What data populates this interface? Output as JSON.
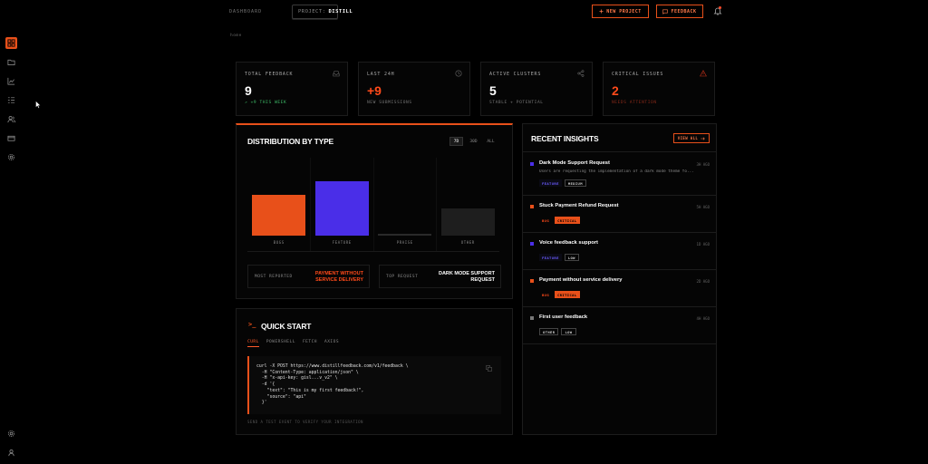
{
  "topbar": {
    "dashboard_label": "DASHBOARD",
    "project_prefix": "PROJECT:",
    "project_name": "DISTILL",
    "new_project_label": "NEW PROJECT",
    "feedback_label": "FEEDBACK"
  },
  "breadcrumb": "home",
  "stats": [
    {
      "label": "TOTAL FEEDBACK",
      "value": "9",
      "sub": "+9 THIS WEEK",
      "icon": "inbox-icon"
    },
    {
      "label": "LAST 24H",
      "value": "+9",
      "sub": "NEW SUBMISSIONS",
      "icon": "clock-icon"
    },
    {
      "label": "ACTIVE CLUSTERS",
      "value": "5",
      "sub": "STABLE + POTENTIAL",
      "icon": "share-icon"
    },
    {
      "label": "CRITICAL ISSUES",
      "value": "2",
      "sub": "NEEDS ATTENTION",
      "icon": "warning-icon"
    }
  ],
  "distribution": {
    "title": "DISTRIBUTION BY TYPE",
    "ranges": [
      "7D",
      "30D",
      "ALL"
    ],
    "active_range": "7D",
    "most_reported_label": "MOST REPORTED",
    "most_reported_value": "PAYMENT WITHOUT SERVICE DELIVERY",
    "top_request_label": "TOP REQUEST",
    "top_request_value": "DARK MODE SUPPORT REQUEST"
  },
  "chart_data": {
    "type": "bar",
    "categories": [
      "BUGS",
      "FEATURE",
      "PRAISE",
      "OTHER"
    ],
    "values": [
      3,
      4,
      0,
      2
    ],
    "colors": [
      "#e8501a",
      "#4a2ee8",
      "#2a2a2a",
      "#1e1e1e"
    ],
    "ylim": [
      0,
      4
    ]
  },
  "quickstart": {
    "title": "QUICK START",
    "tabs": [
      "CURL",
      "POWERSHELL",
      "FETCH",
      "AXIOS"
    ],
    "active_tab": "CURL",
    "code": "curl -X POST https://www.distillfeedback.com/v1/feedback \\\n  -H \"Content-Type: application/json\" \\\n  -H \"x-api-key: gisl...v_v2\" \\\n  -d '{\n    \"text\": \"This is my first feedback!\",\n    \"source\": \"api\"\n  }'",
    "footer": "SEND A TEST EVENT TO VERIFY YOUR INTEGRATION"
  },
  "insights": {
    "title": "RECENT INSIGHTS",
    "view_all_label": "VIEW ALL",
    "items": [
      {
        "title": "Dark Mode Support Request",
        "ago": "3H AGO",
        "desc": "Users are requesting the implementation of a dark mode theme fo...",
        "tags": [
          "FEATURE",
          "MEDIUM"
        ],
        "color": "#4a2ee8"
      },
      {
        "title": "Stuck Payment Refund Request",
        "ago": "5H AGO",
        "desc": "",
        "tags": [
          "BUG",
          "CRITICAL"
        ],
        "color": "#e8501a"
      },
      {
        "title": "Voice feedback support",
        "ago": "1D AGO",
        "desc": "",
        "tags": [
          "FEATURE",
          "LOW"
        ],
        "color": "#4a2ee8"
      },
      {
        "title": "Payment without service delivery",
        "ago": "2D AGO",
        "desc": "",
        "tags": [
          "BUG",
          "CRITICAL"
        ],
        "color": "#e8501a"
      },
      {
        "title": "First user feedback",
        "ago": "4H AGO",
        "desc": "",
        "tags": [
          "OTHER",
          "LOW"
        ],
        "color": "#777777"
      }
    ]
  }
}
